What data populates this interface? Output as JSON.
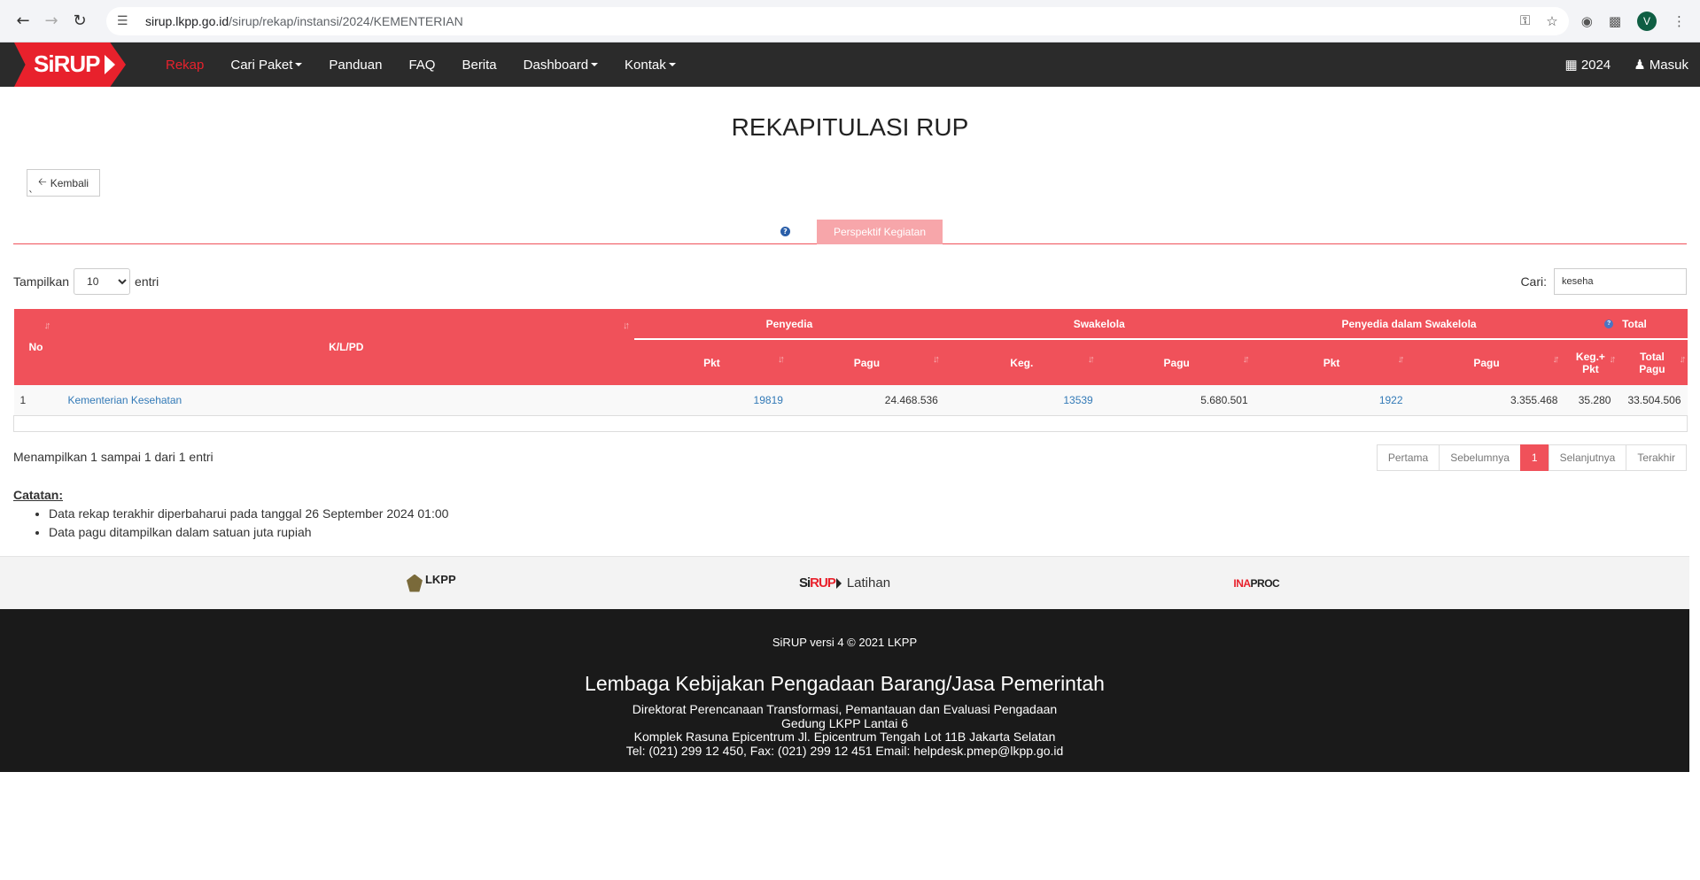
{
  "browser": {
    "url_host": "sirup.lkpp.go.id",
    "url_path": "/sirup/rekap/instansi/2024/KEMENTERIAN",
    "profile_initial": "V"
  },
  "navbar": {
    "logo_si": "Si",
    "logo_rup": "RUP",
    "items": [
      {
        "label": "Rekap",
        "active": true
      },
      {
        "label": "Cari Paket",
        "dropdown": true
      },
      {
        "label": "Panduan"
      },
      {
        "label": "FAQ"
      },
      {
        "label": "Berita"
      },
      {
        "label": "Dashboard",
        "dropdown": true
      },
      {
        "label": "Kontak",
        "dropdown": true
      }
    ],
    "year": "2024",
    "login": "Masuk"
  },
  "page": {
    "title": "REKAPITULASI RUP",
    "back_label": "Kembali",
    "tick": "`",
    "tab_label": "Perspektif Kegiatan"
  },
  "controls": {
    "show_prefix": "Tampilkan",
    "show_value": "10",
    "show_suffix": "entri",
    "search_label": "Cari:",
    "search_value": "keseha"
  },
  "table": {
    "headers": {
      "no": "No",
      "klpd": "K/L/PD",
      "penyedia": "Penyedia",
      "swakelola": "Swakelola",
      "penyedia_swakelola": "Penyedia dalam Swakelola",
      "total": "Total",
      "pkt": "Pkt",
      "pagu": "Pagu",
      "keg": "Keg.",
      "keg_pkt": "Keg.+ Pkt",
      "total_pagu": "Total Pagu"
    },
    "rows": [
      {
        "no": "1",
        "klpd": "Kementerian Kesehatan",
        "penyedia_pkt": "19819",
        "penyedia_pagu": "24.468.536",
        "swakelola_keg": "13539",
        "swakelola_pagu": "5.680.501",
        "pds_pkt": "1922",
        "pds_pagu": "3.355.468",
        "total_keg_pkt": "35.280",
        "total_pagu": "33.504.506"
      }
    ]
  },
  "info": "Menampilkan 1 sampai 1 dari 1 entri",
  "pagination": {
    "first": "Pertama",
    "prev": "Sebelumnya",
    "current": "1",
    "next": "Selanjutnya",
    "last": "Terakhir"
  },
  "notes": {
    "label": "Catatan:",
    "items": [
      "Data rekap terakhir diperbaharui pada tanggal 26 September 2024 01:00",
      "Data pagu ditampilkan dalam satuan juta rupiah"
    ]
  },
  "partners": {
    "lkpp": "LKPP",
    "sirup_si": "Si",
    "sirup_rup": "RUP",
    "sirup_suffix": "Latihan",
    "inaproc_ina": "INA",
    "inaproc_proc": "PROC"
  },
  "footer": {
    "version": "SiRUP versi 4 © 2021 LKPP",
    "org": "Lembaga Kebijakan Pengadaan Barang/Jasa Pemerintah",
    "line1": "Direktorat Perencanaan Transformasi, Pemantauan dan Evaluasi Pengadaan",
    "line2": "Gedung LKPP Lantai 6",
    "line3": "Komplek Rasuna Epicentrum Jl. Epicentrum Tengah Lot 11B Jakarta Selatan",
    "line4": "Tel: (021) 299 12 450, Fax: (021) 299 12 451 Email: helpdesk.pmep@lkpp.go.id"
  }
}
